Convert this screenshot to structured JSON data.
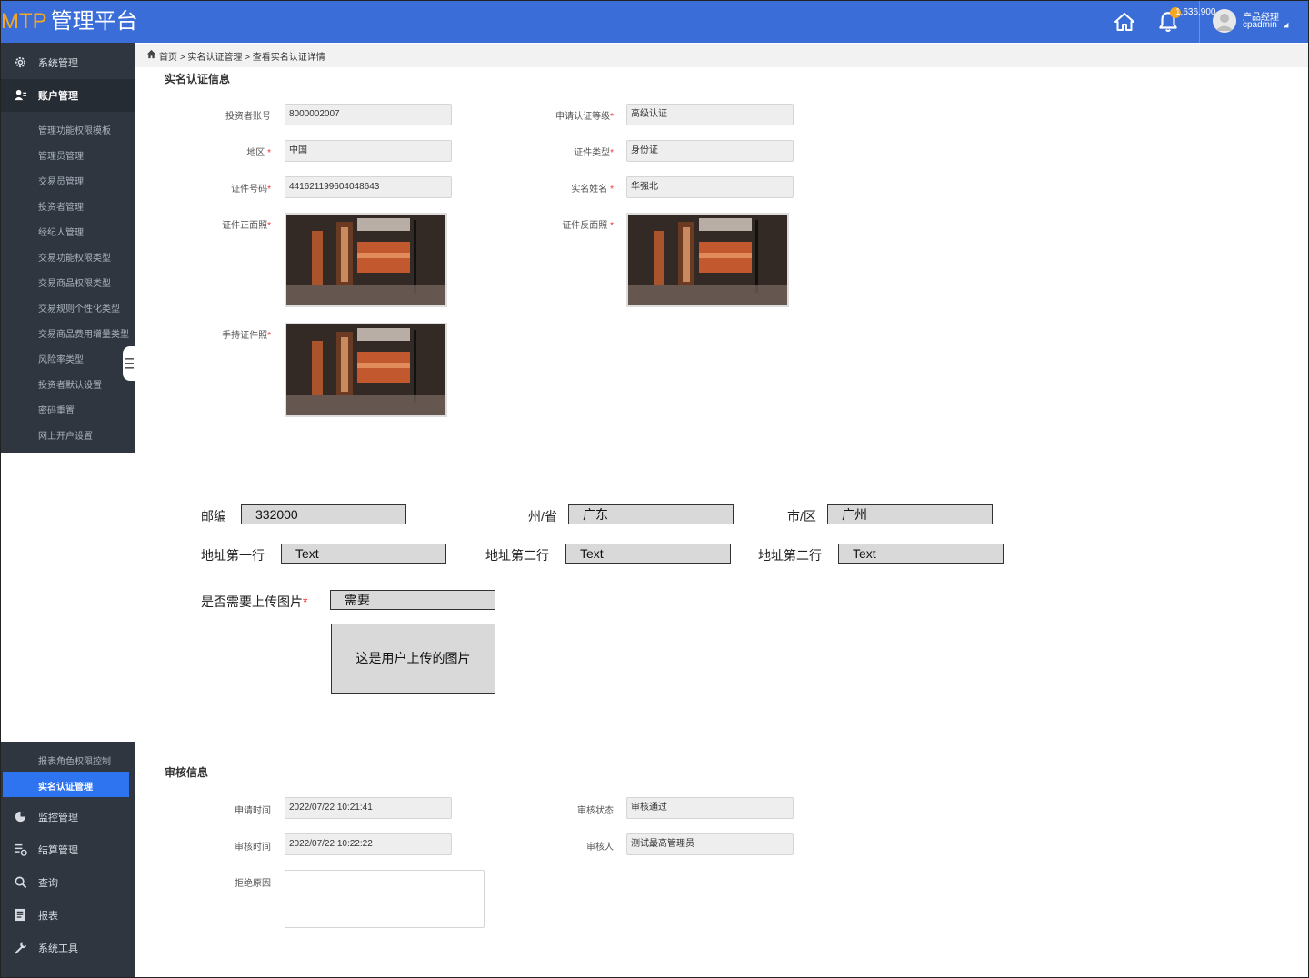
{
  "header": {
    "brand_mtp": "MTP",
    "brand_platform": "管理平台",
    "notification_count": "1,636,900",
    "user_role": "产品经理",
    "username": "cpadmin"
  },
  "sidebar": {
    "groups": [
      {
        "label": "系统管理",
        "icon": "gear-icon"
      },
      {
        "label": "账户管理",
        "icon": "user-group-icon"
      }
    ],
    "account_items": [
      {
        "label": "管理功能权限模板"
      },
      {
        "label": "管理员管理"
      },
      {
        "label": "交易员管理"
      },
      {
        "label": "投资者管理"
      },
      {
        "label": "经纪人管理"
      },
      {
        "label": "交易功能权限类型"
      },
      {
        "label": "交易商品权限类型"
      },
      {
        "label": "交易规则个性化类型"
      },
      {
        "label": "交易商品费用增量类型"
      },
      {
        "label": "风险率类型"
      },
      {
        "label": "投资者默认设置"
      },
      {
        "label": "密码重置"
      },
      {
        "label": "网上开户设置"
      },
      {
        "label": "报表角色权限控制"
      },
      {
        "label": "实名认证管理"
      }
    ],
    "lower_groups": [
      {
        "label": "监控管理",
        "icon": "pie-chart-icon"
      },
      {
        "label": "结算管理",
        "icon": "settlement-icon"
      },
      {
        "label": "查询",
        "icon": "search-icon"
      },
      {
        "label": "报表",
        "icon": "report-icon"
      },
      {
        "label": "系统工具",
        "icon": "wrench-icon"
      }
    ],
    "active_item": "实名认证管理"
  },
  "breadcrumb": "首页 > 实名认证管理 > 查看实名认证详情",
  "realname": {
    "section_title": "实名认证信息",
    "investor_account_label": "投资者账号",
    "investor_account": "8000002007",
    "level_label": "申请认证等级",
    "level": "高级认证",
    "region_label": "地区 ",
    "region": "中国",
    "cert_type_label": "证件类型",
    "cert_type": "身份证",
    "cert_no_label": "证件号码",
    "cert_no": "441621199604048643",
    "real_name_label": "实名姓名 ",
    "real_name": "华强北",
    "front_photo_label": "证件正面照",
    "back_photo_label": "证件反面照 ",
    "hand_photo_label": "手持证件照"
  },
  "address": {
    "zip_label": "邮编",
    "zip": "332000",
    "province_label": "州/省",
    "province": "广东",
    "city_label": "市/区",
    "city": "广州",
    "line1_label": "地址第一行",
    "line1": "Text",
    "line2_label": "地址第二行",
    "line2": "Text",
    "line3_label": "地址第二行",
    "line3": "Text",
    "need_upload_label": "是否需要上传图片",
    "need_upload": "需要",
    "upload_placeholder": "这是用户上传的图片"
  },
  "review": {
    "section_title": "审核信息",
    "apply_time_label": "申请时间",
    "apply_time": "2022/07/22 10:21:41",
    "status_label": "审核状态",
    "status": "审核通过",
    "review_time_label": "审核时间",
    "review_time": "2022/07/22 10:22:22",
    "reviewer_label": "审核人",
    "reviewer": "测试最高管理员",
    "reject_reason_label": "拒绝原因",
    "reject_reason": ""
  },
  "colors": {
    "header_bg": "#3a6dd8",
    "brand_accent": "#f5a623",
    "sidebar_bg": "#2f3640",
    "active_item": "#2e73f0"
  }
}
